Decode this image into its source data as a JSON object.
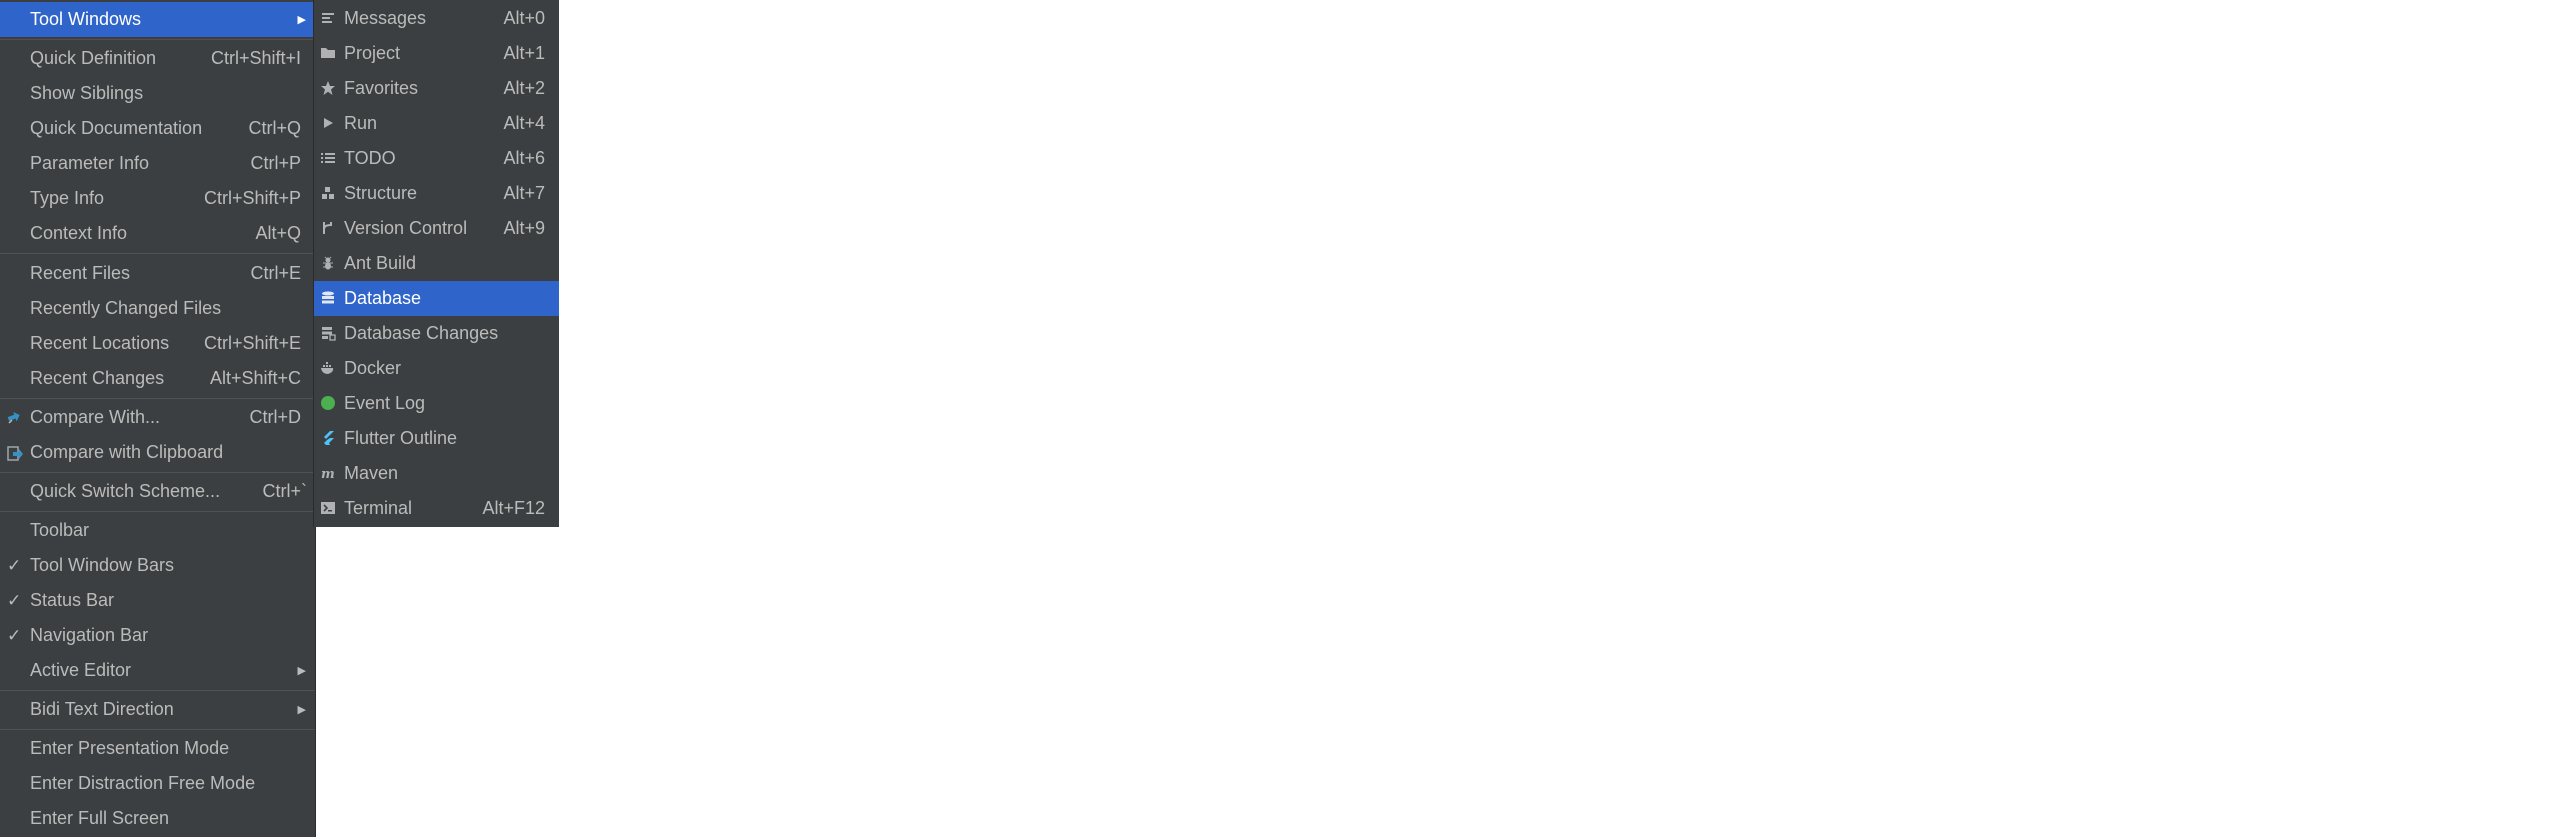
{
  "main_menu": {
    "tool_windows": "Tool Windows",
    "quick_definition": {
      "label": "Quick Definition",
      "shortcut": "Ctrl+Shift+I"
    },
    "show_siblings": {
      "label": "Show Siblings"
    },
    "quick_documentation": {
      "label": "Quick Documentation",
      "shortcut": "Ctrl+Q"
    },
    "parameter_info": {
      "label": "Parameter Info",
      "shortcut": "Ctrl+P"
    },
    "type_info": {
      "label": "Type Info",
      "shortcut": "Ctrl+Shift+P"
    },
    "context_info": {
      "label": "Context Info",
      "shortcut": "Alt+Q"
    },
    "recent_files": {
      "label": "Recent Files",
      "shortcut": "Ctrl+E"
    },
    "recently_changed_files": {
      "label": "Recently Changed Files"
    },
    "recent_locations": {
      "label": "Recent Locations",
      "shortcut": "Ctrl+Shift+E"
    },
    "recent_changes": {
      "label": "Recent Changes",
      "shortcut": "Alt+Shift+C"
    },
    "compare_with": {
      "label": "Compare With...",
      "shortcut": "Ctrl+D"
    },
    "compare_clipboard": {
      "label": "Compare with Clipboard"
    },
    "quick_switch_scheme": {
      "label": "Quick Switch Scheme...",
      "shortcut": "Ctrl+`"
    },
    "toolbar": {
      "label": "Toolbar"
    },
    "tool_window_bars": {
      "label": "Tool Window Bars",
      "checked": true
    },
    "status_bar": {
      "label": "Status Bar",
      "checked": true
    },
    "navigation_bar": {
      "label": "Navigation Bar",
      "checked": true
    },
    "active_editor": {
      "label": "Active Editor"
    },
    "bidi_text_direction": {
      "label": "Bidi Text Direction"
    },
    "presentation_mode": {
      "label": "Enter Presentation Mode"
    },
    "distraction_free_mode": {
      "label": "Enter Distraction Free Mode"
    },
    "full_screen": {
      "label": "Enter Full Screen"
    }
  },
  "check_glyph": "✓",
  "arrow_glyph": "▶",
  "sub_menu": {
    "items": [
      {
        "label": "Messages",
        "shortcut": "Alt+0",
        "icon": "messages-icon"
      },
      {
        "label": "Project",
        "shortcut": "Alt+1",
        "icon": "folder-icon"
      },
      {
        "label": "Favorites",
        "shortcut": "Alt+2",
        "icon": "star-icon"
      },
      {
        "label": "Run",
        "shortcut": "Alt+4",
        "icon": "run-icon"
      },
      {
        "label": "TODO",
        "shortcut": "Alt+6",
        "icon": "todo-list-icon"
      },
      {
        "label": "Structure",
        "shortcut": "Alt+7",
        "icon": "structure-icon"
      },
      {
        "label": "Version Control",
        "shortcut": "Alt+9",
        "icon": "version-control-icon"
      },
      {
        "label": "Ant Build",
        "shortcut": "",
        "icon": "ant-icon"
      },
      {
        "label": "Database",
        "shortcut": "",
        "icon": "database-icon",
        "selected": true
      },
      {
        "label": "Database Changes",
        "shortcut": "",
        "icon": "database-changes-icon"
      },
      {
        "label": "Docker",
        "shortcut": "",
        "icon": "docker-icon"
      },
      {
        "label": "Event Log",
        "shortcut": "",
        "icon": "event-log-icon"
      },
      {
        "label": "Flutter Outline",
        "shortcut": "",
        "icon": "flutter-icon"
      },
      {
        "label": "Maven",
        "shortcut": "",
        "icon": "maven-icon"
      },
      {
        "label": "Terminal",
        "shortcut": "Alt+F12",
        "icon": "terminal-icon"
      }
    ]
  },
  "colors": {
    "menu_bg": "#3c3f41",
    "selection": "#2f65ca",
    "text": "#bbbbbb",
    "event_log_green": "#4caf50",
    "flutter_blue": "#4fc3f7",
    "compare_blue": "#3592c4"
  }
}
